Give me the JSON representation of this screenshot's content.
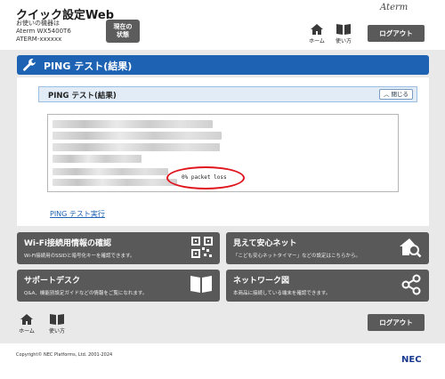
{
  "header": {
    "app_title": "クイック設定Web",
    "device_label": "お使いの機器は",
    "device_model": "Aterm WX5400T6",
    "device_ssid": "ATERM-xxxxxx",
    "status_button_line1": "現在の",
    "status_button_line2": "状態",
    "brand": "Aterm",
    "home_label": "ホーム",
    "help_label": "使い方",
    "logout_label": "ログアウト"
  },
  "page": {
    "title": "PING テスト(結果)",
    "section_title": "PING テスト(結果)",
    "close_label": "閉じる",
    "result_text": "0% packet loss",
    "run_link": "PING テスト実行"
  },
  "tiles": [
    {
      "title": "Wi-Fi接続用情報の確認",
      "desc": "Wi-Fi接続用のSSIDと暗号化キーを確認できます。",
      "icon": "qr-code-icon"
    },
    {
      "title": "見えて安心ネット",
      "desc": "「こども安心ネットタイマー」などの設定はこちらから。",
      "icon": "house-search-icon"
    },
    {
      "title": "サポートデスク",
      "desc": "Q&A、機能別設定ガイドなどの情報をご覧になれます。",
      "icon": "book-icon"
    },
    {
      "title": "ネットワーク図",
      "desc": "本商品に接続している端末を確認できます。",
      "icon": "network-icon"
    }
  ],
  "footer": {
    "home_label": "ホーム",
    "help_label": "使い方",
    "logout_label": "ログアウト",
    "copyright": "Copyright© NEC Platforms, Ltd. 2001-2024",
    "logo": "NEC"
  },
  "colors": {
    "accent_blue": "#1d62b3",
    "tile_gray": "#595959",
    "highlight_red": "#e0141e"
  }
}
